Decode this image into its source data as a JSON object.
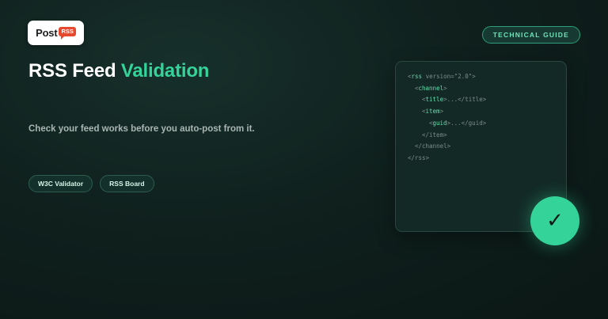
{
  "logo": {
    "text": "Post",
    "bubble": "RSS"
  },
  "badge": "TECHNICAL GUIDE",
  "title": {
    "main": "RSS Feed",
    "accent": "Validation"
  },
  "subtitle": "Check your feed works before you auto-post from it.",
  "chips": [
    "W3C Validator",
    "RSS Board"
  ],
  "code": [
    {
      "indent": 0,
      "tag": "rss",
      "attr": " version=\"2.0\"",
      "close": ">"
    },
    {
      "indent": 1,
      "tag": "channel",
      "close": ">"
    },
    {
      "indent": 2,
      "tag": "title",
      "close": ">...</title>"
    },
    {
      "indent": 2,
      "tag": "item",
      "close": ">"
    },
    {
      "indent": 3,
      "tag": "guid",
      "close": ">...</guid>"
    },
    {
      "indent": 2,
      "text": "</item>"
    },
    {
      "indent": 1,
      "text": "</channel>"
    },
    {
      "indent": 0,
      "text": "</rss>"
    }
  ],
  "check_icon": "✓",
  "colors": {
    "accent": "#34d399",
    "background": "#0f201d",
    "tag": "#5ee0ac"
  }
}
